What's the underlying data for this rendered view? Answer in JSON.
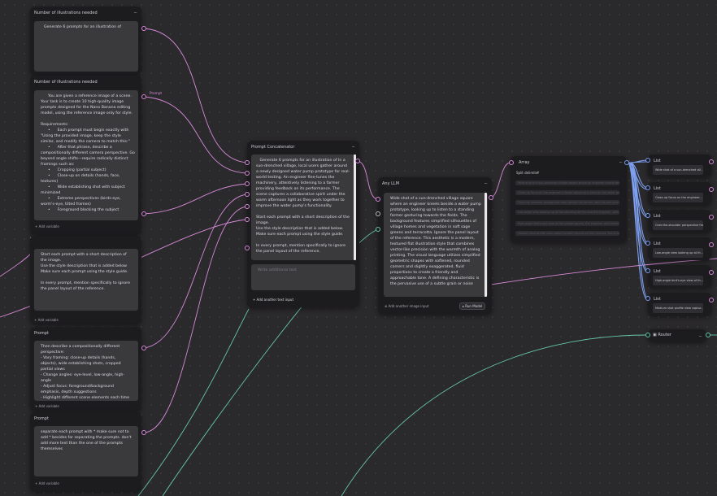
{
  "left_nodes": [
    {
      "title": "Number of illustrations needed",
      "menu": "...",
      "text": "Generate 6 prompts for an illustration of",
      "port_label": ""
    },
    {
      "title": "Number of illustrations needed",
      "menu": "...",
      "text": "      You are given a reference image of a scene. Your task is to create 10 high-quality image prompts designed for the Nano Banana editing model, using the reference image only for style.\n\nRequirements:\n      •      Each prompt must begin exactly with \"Using the provided image, keep the style similar, and modify the camera to match this:\"\n      •      After that phrase, describe a compositionally different camera perspective. Go beyond angle shifts—require radically distinct framings such as:\n      •      Cropping (partial subject)\n      •      Close-up on details (hands, face, textures)\n      •      Wide establishing shot with subject minimized\n      •      Extreme perspectives (birds-eye, worm's-eye, tilted frames)\n      •      Foreground blocking the subject",
      "add_variable": "Add variable",
      "port_label": "Prompt"
    },
    {
      "text": "Start each prompt with a short description of the image.\nUse the style description that is added below\nMake sure each prompt using the style guide.\n\nIn every prompt, mention specifically to ignore the panel layout of the reference.",
      "add_variable": "Add variable"
    },
    {
      "title": "Prompt",
      "menu": "...",
      "text": "Then describe a compositionally different perspective:\n- Vary framing: close-up details (hands, objects), wide establishing shots, cropped partial views\n- Change angles: eye-level, low-angle, high-angle\n- Adjust focus: foreground/background emphasis, depth suggestions\n- Highlight different scene elements each time",
      "add_variable": "Add variable"
    },
    {
      "title": "Prompt",
      "menu": "...",
      "text": "separate each prompt with * make sure not to add * besides for separating the prompts. don't add more text than the one of the prompts themselves",
      "add_variable": "Add variable"
    }
  ],
  "concat": {
    "title": "Prompt Concatenator",
    "menu": "...",
    "text": "   Generate 6 prompts for an illustration of In a sun-drenched village, local users gather around a newly designed water pump prototype for real-world testing. An engineer fine-tunes the machinery, attentively listening to a farmer providing feedback on its performance. The scene captures a collaborative spirit under the warm afternoon light as they work together to improve the water pump's functionality.\n\nStart each prompt with a short description of the image.\nUse the style description that is added below. Make sure each prompt using the style guide.\n\nIn every prompt, mention specifically to ignore the panel layout of the reference.",
    "placeholder": "Write additional text",
    "add_input": "+ Add another text input"
  },
  "llm": {
    "title": "Any LLM",
    "menu": "...",
    "text": "Wide shot of a sun-drenched village square where an engineer kneels beside a water pump prototype, looking up to listen to a standing farmer gesturing towards the fields. The background features simplified silhouettes of village homes and vegetation in soft sage greens and terracotta. Ignore the panel layout of the reference. This aesthetic is a modern, textured flat illustration style that combines vector-like precision with the warmth of analog printing. The visual language utilizes simplified geometric shapes with softened, rounded corners and slightly exaggerated, fluid proportions to create a friendly and approachable tone. A defining characteristic is the pervasive use of a subtle grain or noise",
    "add_image": "Add another image input",
    "run_button": "Run Model"
  },
  "array": {
    "title": "Array",
    "menu": "...",
    "split_label": "Split delimiter",
    "split_value": "*",
    "rows": [
      "Wide shot of a sun-drenched village square where an engineer kneels beside a water pump prototype",
      "Close-up focus on the engineer's hands adjusting a valve on the water pump, with the farmer's boots",
      "Over-the-shoulder perspective from behind the farmer, with his arm and shoulder blurred in the",
      "Low-angle view looking up at the standing farmer and the engineer, with the water pump towering",
      "High-angle bird's-eye view of the village square, the engineer and farmer small figures beside",
      "Medium shot profile view capturing both figures as they discuss, the engineer holding a wrench"
    ]
  },
  "lists": [
    {
      "title": "List",
      "value": "Wide shot of a sun-drenched vill..."
    },
    {
      "title": "List",
      "value": "Close-up focus on the engineer..."
    },
    {
      "title": "List",
      "value": "Over-the-shoulder perspective fro..."
    },
    {
      "title": "List",
      "value": "Low-angle view looking up at th..."
    },
    {
      "title": "List",
      "value": "High-angle bird's-eye view of th..."
    },
    {
      "title": "List",
      "value": "Medium shot profile view captur..."
    }
  ],
  "router": {
    "title": "Router",
    "menu": "..."
  },
  "colors": {
    "canvas": "#2a292b",
    "node": "#1c1b1e",
    "text_wire": "#d68ad8",
    "image_wire": "#66c8a8",
    "list_wire": "#7ea0f0"
  }
}
